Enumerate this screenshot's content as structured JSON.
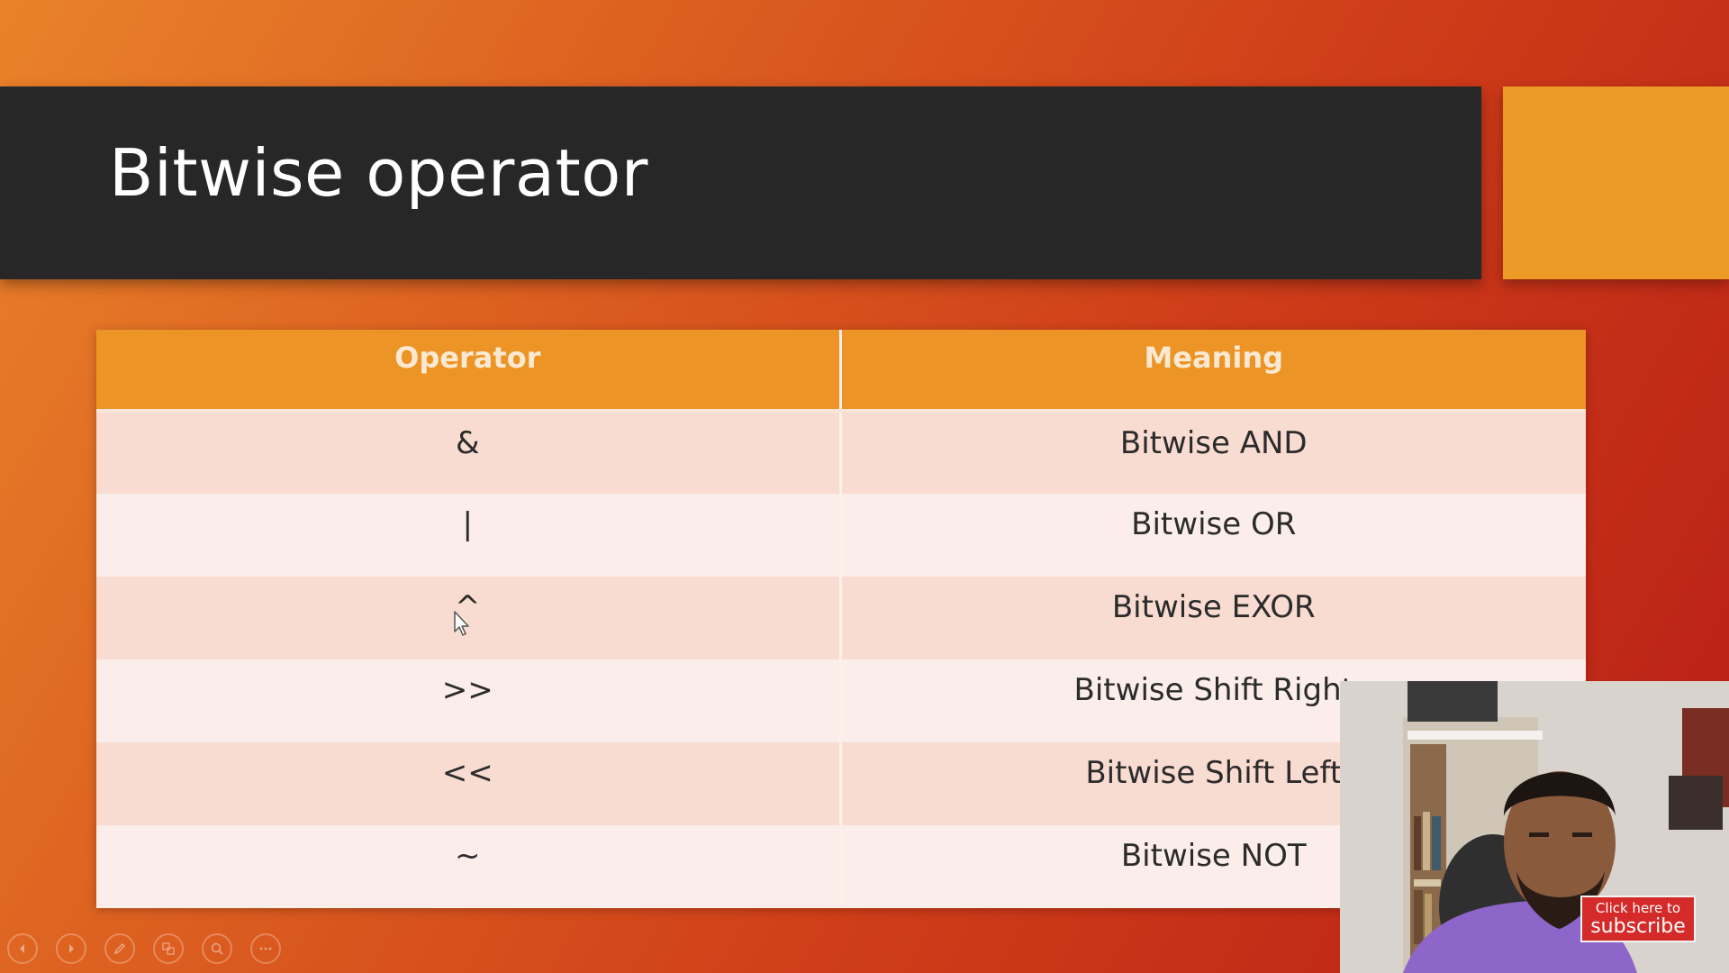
{
  "slide": {
    "title": "Bitwise operator",
    "colors": {
      "title_bar": "#272727",
      "accent_block": "#ee9a26",
      "table_header": "#ec9526",
      "row_odd": "#f9dcd1",
      "row_even": "#fbeeea",
      "background_from": "#e9822a",
      "background_to": "#b81d16"
    }
  },
  "table": {
    "headers": [
      "Operator",
      "Meaning"
    ],
    "rows": [
      {
        "operator": "&",
        "meaning": "Bitwise AND"
      },
      {
        "operator": "|",
        "meaning": "Bitwise OR"
      },
      {
        "operator": "^",
        "meaning": "Bitwise EXOR"
      },
      {
        "operator": ">>",
        "meaning": "Bitwise Shift Right"
      },
      {
        "operator": "<<",
        "meaning": "Bitwise Shift Left"
      },
      {
        "operator": "~",
        "meaning": "Bitwise NOT"
      }
    ]
  },
  "toolbar": {
    "buttons": [
      {
        "name": "previous-slide-button",
        "icon": "arrow-left-icon"
      },
      {
        "name": "next-slide-button",
        "icon": "arrow-right-icon"
      },
      {
        "name": "pen-tool-button",
        "icon": "pen-icon"
      },
      {
        "name": "see-all-slides-button",
        "icon": "slides-icon"
      },
      {
        "name": "zoom-button",
        "icon": "magnifier-icon"
      },
      {
        "name": "more-options-button",
        "icon": "ellipsis-icon"
      }
    ]
  },
  "overlay": {
    "subscribe_line1": "Click here to",
    "subscribe_line2": "subscribe"
  }
}
